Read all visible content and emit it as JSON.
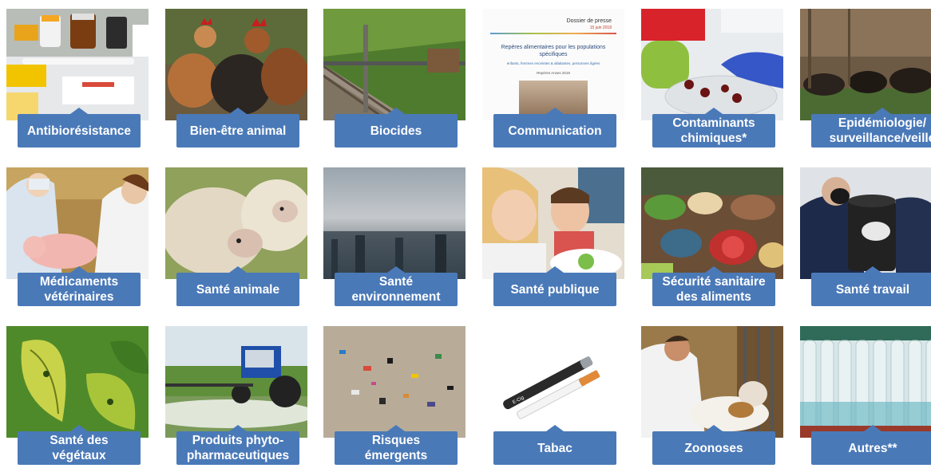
{
  "tiles": [
    {
      "label": "Antibiorésistance",
      "image": "pills-syringe-photo"
    },
    {
      "label": "Bien-être animal",
      "image": "hens-photo"
    },
    {
      "label": "Biocides",
      "image": "railway-photo"
    },
    {
      "label": "Communication",
      "image": "press-kit-cover-photo",
      "doc_title": "Dossier de presse",
      "doc_date": "15 juin 2018",
      "doc_heading": "Repères alimentaires pour les populations spécifiques",
      "doc_sub": "enfants, femmes enceintes & allaitantes, personnes âgées",
      "doc_foot": "Repères Anses 2019"
    },
    {
      "label": "Contaminants\nchimiques*",
      "image": "lab-gloved-hand-photo"
    },
    {
      "label": "Epidémiologie/\nsurveillance/veille",
      "image": "wild-boars-photo"
    },
    {
      "label": "Médicaments\nvétérinaires",
      "image": "vet-piglet-photo"
    },
    {
      "label": "Santé animale",
      "image": "sheep-photo"
    },
    {
      "label": "Santé\nenvironnement",
      "image": "smog-city-photo"
    },
    {
      "label": "Santé publique",
      "image": "children-eating-photo"
    },
    {
      "label": "Sécurité sanitaire\ndes aliments",
      "image": "food-table-photo"
    },
    {
      "label": "Santé travail",
      "image": "worker-mask-photo"
    },
    {
      "label": "Santé des\nvégétaux",
      "image": "leaves-photo"
    },
    {
      "label": "Produits phyto-\npharmaceutiques",
      "image": "tractor-spraying-photo"
    },
    {
      "label": "Risques\némergents",
      "image": "microplastics-photo"
    },
    {
      "label": "Tabac",
      "image": "e-cigarette-photo",
      "ecig_brand": "E-Cig"
    },
    {
      "label": "Zoonoses",
      "image": "vet-calf-photo"
    },
    {
      "label": "Autres**",
      "image": "test-tubes-photo"
    }
  ]
}
